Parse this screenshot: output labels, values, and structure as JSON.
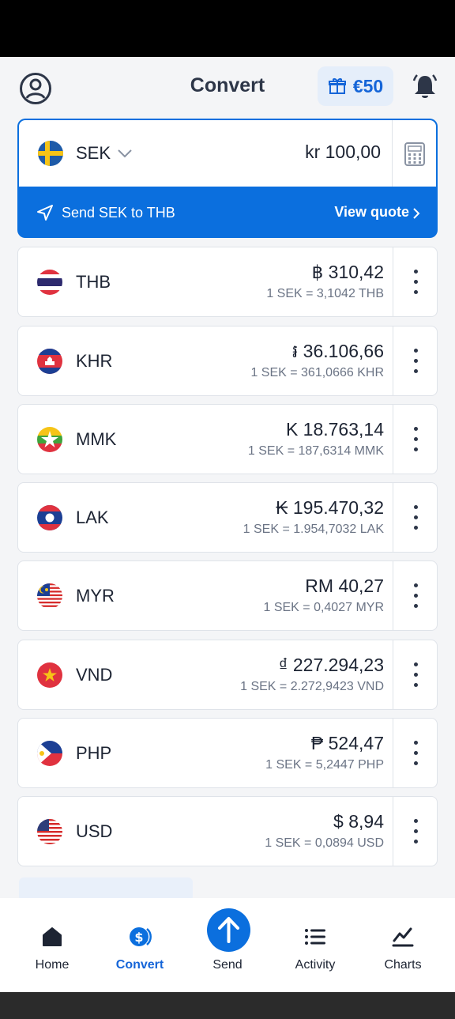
{
  "header": {
    "title": "Convert",
    "promo_amount": "€50"
  },
  "base": {
    "code": "SEK",
    "amount": "kr 100,00",
    "send_label": "Send SEK to THB",
    "quote_label": "View quote"
  },
  "rows": [
    {
      "code": "THB",
      "amount": "฿ 310,42",
      "rate": "1 SEK = 3,1042 THB",
      "flag": "thailand-flag-icon"
    },
    {
      "code": "KHR",
      "amount": "៛ 36.106,66",
      "rate": "1 SEK = 361,0666 KHR",
      "flag": "cambodia-flag-icon"
    },
    {
      "code": "MMK",
      "amount": "K 18.763,14",
      "rate": "1 SEK = 187,6314 MMK",
      "flag": "myanmar-flag-icon"
    },
    {
      "code": "LAK",
      "amount": "₭ 195.470,32",
      "rate": "1 SEK = 1.954,7032 LAK",
      "flag": "laos-flag-icon"
    },
    {
      "code": "MYR",
      "amount": "RM 40,27",
      "rate": "1 SEK = 0,4027 MYR",
      "flag": "malaysia-flag-icon"
    },
    {
      "code": "VND",
      "amount": "₫ 227.294,23",
      "rate": "1 SEK = 2.272,9423 VND",
      "flag": "vietnam-flag-icon"
    },
    {
      "code": "PHP",
      "amount": "₱ 524,47",
      "rate": "1 SEK = 5,2447 PHP",
      "flag": "philippines-flag-icon"
    },
    {
      "code": "USD",
      "amount": "$ 8,94",
      "rate": "1 SEK = 0,0894 USD",
      "flag": "usa-flag-icon"
    }
  ],
  "nav": {
    "home": "Home",
    "convert": "Convert",
    "send": "Send",
    "activity": "Activity",
    "charts": "Charts"
  },
  "colors": {
    "accent": "#0b6fde",
    "active_nav": "#1565d8",
    "text": "#1d2433",
    "muted": "#6b7485"
  }
}
